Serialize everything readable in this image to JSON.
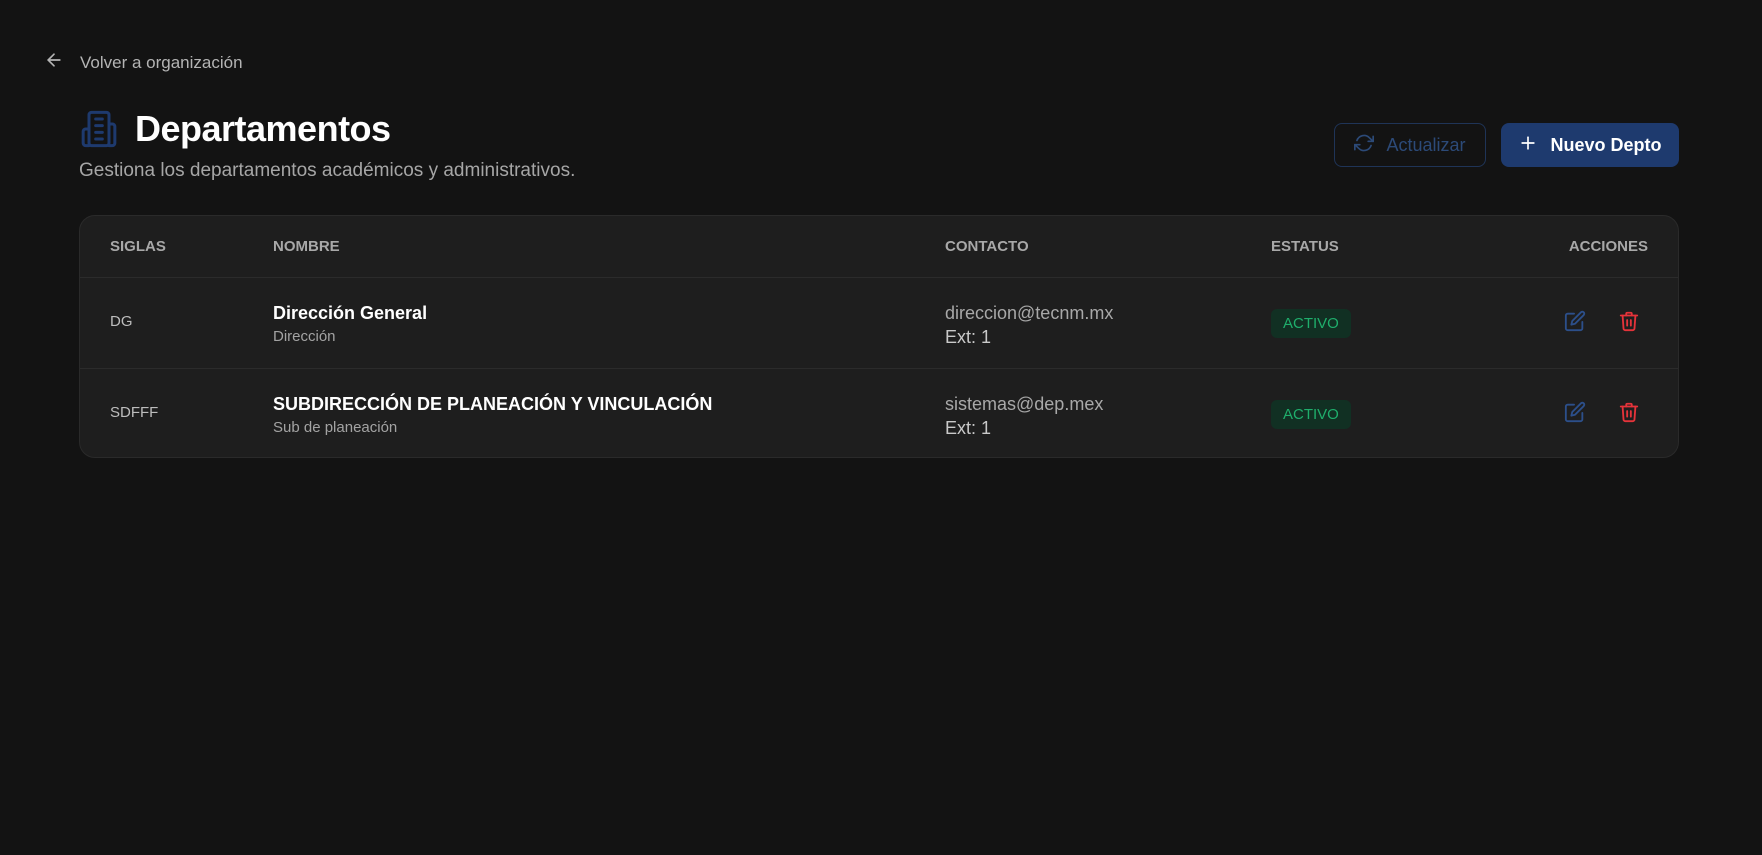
{
  "nav": {
    "back_label": "Volver a organización"
  },
  "header": {
    "title": "Departamentos",
    "subtitle": "Gestiona los departamentos académicos y administrativos.",
    "refresh_label": "Actualizar",
    "new_label": "Nuevo Depto"
  },
  "table": {
    "columns": {
      "siglas": "SIGLAS",
      "nombre": "NOMBRE",
      "contacto": "CONTACTO",
      "estatus": "ESTATUS",
      "acciones": "ACCIONES"
    },
    "rows": [
      {
        "siglas": "DG",
        "nombre": "Dirección General",
        "tipo": "Dirección",
        "email": "direccion@tecnm.mx",
        "ext": "Ext: 1",
        "estatus": "ACTIVO"
      },
      {
        "siglas": "SDFFF",
        "nombre": "SUBDIRECCIÓN DE PLANEACIÓN Y VINCULACIÓN",
        "tipo": "Sub de planeación",
        "email": "sistemas@dep.mex",
        "ext": "Ext: 1",
        "estatus": "ACTIVO"
      }
    ]
  },
  "colors": {
    "background": "#131313",
    "card": "#1e1e1e",
    "accent_blue": "#1e3a6e",
    "status_green": "#1fae6c",
    "delete_red": "#e5333a"
  }
}
